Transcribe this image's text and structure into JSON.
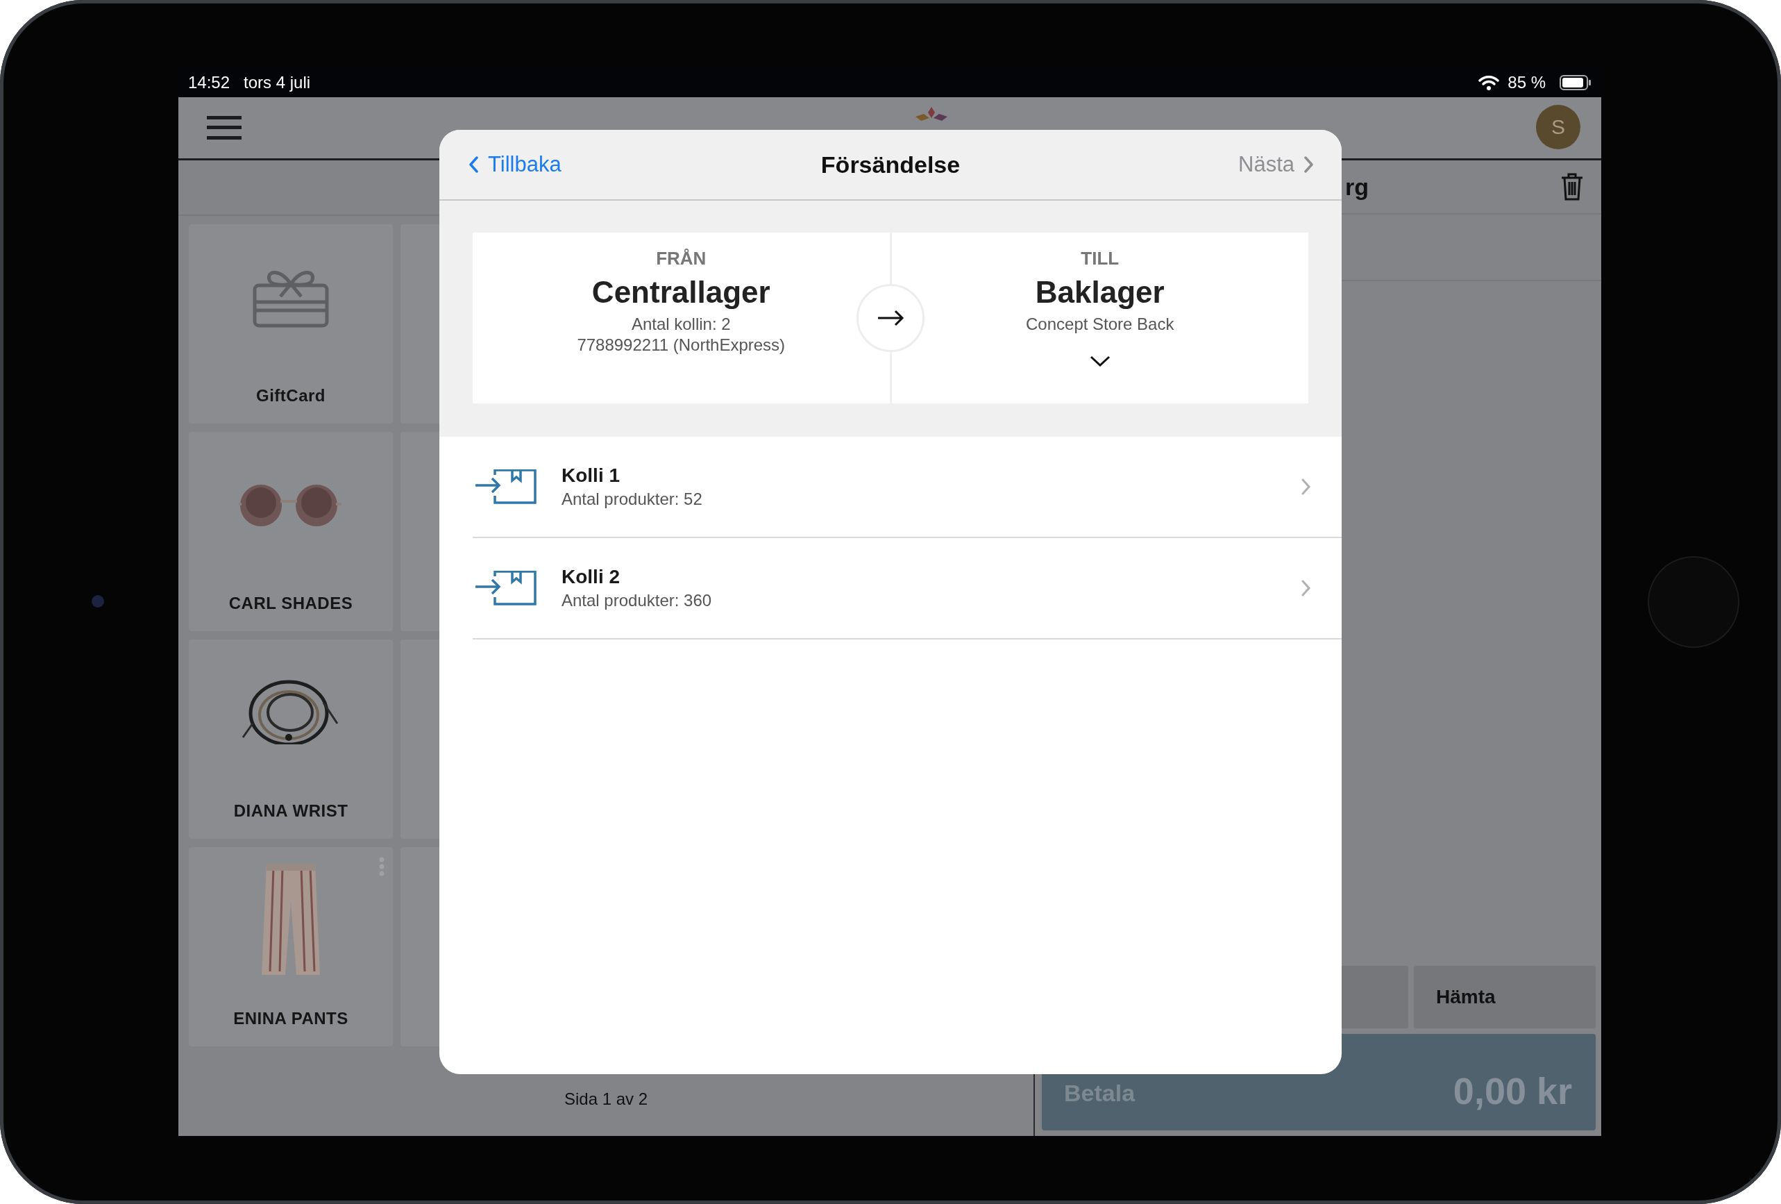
{
  "status_bar": {
    "time": "14:52",
    "date": "tors 4 juli",
    "battery": "85 %"
  },
  "app_bar": {
    "avatar": "S"
  },
  "cart": {
    "title": "rg"
  },
  "products": [
    {
      "name": "GiftCard",
      "kind": "icon",
      "has_menu": false
    },
    {
      "name": "CARL SHADES",
      "kind": "picture",
      "has_menu": false
    },
    {
      "name": "DIANA WRIST",
      "kind": "picture",
      "has_menu": false
    },
    {
      "name": "ENINA PANTS",
      "kind": "picture",
      "has_menu": true
    }
  ],
  "pagination": "Sida 1 av 2",
  "actions": [
    {
      "label": "Hämta"
    }
  ],
  "pay": {
    "label": "Betala",
    "total": "0,00 kr"
  },
  "modal": {
    "title": "Försändelse",
    "back": "Tillbaka",
    "next": {
      "label": "Nästa",
      "disabled": true
    },
    "from": {
      "label": "FRÅN",
      "name": "Centrallager",
      "lines": [
        "Antal kollin: 2",
        "7788992211 (NorthExpress)"
      ]
    },
    "to": {
      "label": "TILL",
      "name": "Baklager",
      "lines": [
        "Concept Store Back"
      ]
    },
    "packages": [
      {
        "title": "Kolli 1",
        "subtitle": "Antal produkter: 52"
      },
      {
        "title": "Kolli 2",
        "subtitle": "Antal produkter: 360"
      }
    ]
  }
}
